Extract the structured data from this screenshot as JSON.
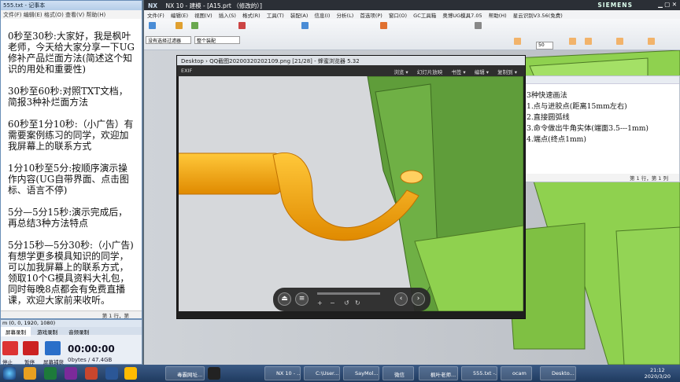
{
  "notepad": {
    "title": "555.txt - 记事本",
    "menu": "文件(F)  编辑(E)  格式(O)  查看(V)  帮助(H)",
    "paragraphs": [
      "0秒至30秒:大家好，我是枫叶老师，今天给大家分享一下UG修补产品烂面方法(简述这个知识的用处和重要性)",
      "30秒至60秒:对照TXT文档，简报3种补烂面方法",
      "60秒至1分10秒:（小广告）有需要案例练习的同学，欢迎加我屏幕上的联系方式",
      "1分10秒至5分:按顺序演示操作内容(UG自带界面、点击图标、语言不停)",
      "5分—5分15秒:演示完成后，再总结3种方法特点",
      "5分15秒—5分30秒:（小广告)有想学更多模具知识的同学，可以加我屏幕上的联系方式，领取10个G模具资料大礼包，同时每晚8点都会有免费直播课，欢迎大家前来收听。"
    ],
    "status": "第 1 行，第"
  },
  "recorder": {
    "title": "m (0, 0, 1920, 1080)",
    "tabs": [
      "屏幕录制",
      "游戏录制",
      "音频录制"
    ],
    "stop": "停止",
    "pause": "暂停",
    "capture": "屏幕捕获",
    "time": "00:00:00",
    "size": "0bytes / 47.4GB"
  },
  "nx": {
    "app": "NX",
    "title": "NX 10 - 建模 - [A15.prt （修改的）]",
    "brand": "SIEMENS",
    "menu": [
      "文件(F)",
      "编辑(E)",
      "视图(V)",
      "插入(S)",
      "格式(R)",
      "工具(T)",
      "装配(A)",
      "信息(I)",
      "分析(L)",
      "首选项(P)",
      "窗口(O)",
      "GC工具箱",
      "奥博UG模具7.05",
      "帮助(H)",
      "星云识别V3.56(免费)"
    ],
    "filter": "没有选择过滤器",
    "scope": "整个装配",
    "zoom": "50"
  },
  "viewer": {
    "title": "Desktop › QQ截图20200320202109.png [21/28] - 蜂蜜浏览器 5.32",
    "exif": "EXIF",
    "tools": [
      "浏览 ▾",
      "幻灯片放映",
      "书签 ▾",
      "编辑 ▾",
      "复制到 ▾"
    ]
  },
  "info": {
    "lines": [
      "3种快速画法",
      "1.点与进胶点(距离15mm左右)",
      "2.直接圆弧线",
      "3.命令做出牛角实体(端面3.5---1mm)",
      "4.端点(终点1mm)"
    ],
    "status": "第 1 行，第 1 列"
  },
  "taskbar": {
    "items": [
      "毒霸网址...",
      "NX 10 - ...",
      "C:\\User...",
      "SayMol...",
      "微信",
      "枫叶老师...",
      "555.txt -...",
      "ocam",
      "Deskto..."
    ],
    "clock_time": "21:12",
    "clock_date": "2020/3/20"
  },
  "colors": {
    "part_orange": "#f4a400",
    "mold_green": "#8fd14f",
    "nx_bg": "#e8ebef"
  }
}
